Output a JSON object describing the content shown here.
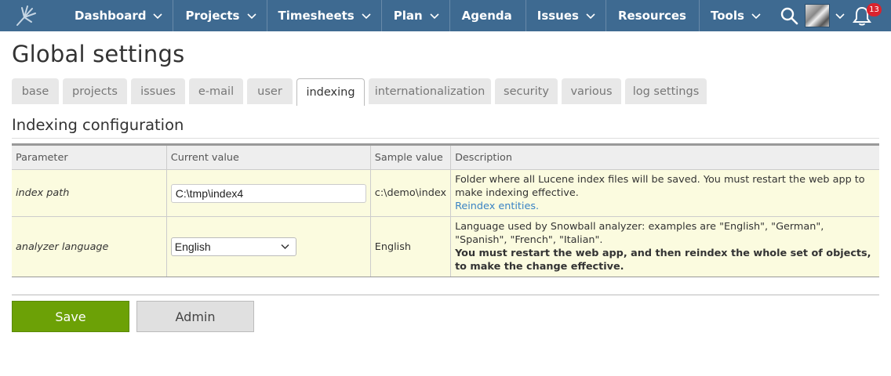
{
  "topbar": {
    "logo_icon": "hand-logo-icon",
    "nav": [
      {
        "label": "Dashboard",
        "has_menu": true
      },
      {
        "label": "Projects",
        "has_menu": true
      },
      {
        "label": "Timesheets",
        "has_menu": true
      },
      {
        "label": "Plan",
        "has_menu": true
      },
      {
        "label": "Agenda",
        "has_menu": false
      },
      {
        "label": "Issues",
        "has_menu": true
      },
      {
        "label": "Resources",
        "has_menu": false
      },
      {
        "label": "Tools",
        "has_menu": true
      }
    ],
    "notifications_count": "13",
    "bar_color": "#3e6a91"
  },
  "page": {
    "title": "Global settings"
  },
  "tabs": [
    {
      "label": "base",
      "active": false
    },
    {
      "label": "projects",
      "active": false
    },
    {
      "label": "issues",
      "active": false
    },
    {
      "label": "e-mail",
      "active": false
    },
    {
      "label": "user",
      "active": false
    },
    {
      "label": "indexing",
      "active": true
    },
    {
      "label": "internationalization",
      "active": false
    },
    {
      "label": "security",
      "active": false
    },
    {
      "label": "various",
      "active": false
    },
    {
      "label": "log settings",
      "active": false
    }
  ],
  "section": {
    "title": "Indexing configuration"
  },
  "table": {
    "headers": {
      "parameter": "Parameter",
      "current_value": "Current value",
      "sample_value": "Sample value",
      "description": "Description"
    },
    "rows": {
      "index_path": {
        "parameter": "index path",
        "value": "C:\\tmp\\index4",
        "sample": "c:\\demo\\index",
        "description": "Folder where all Lucene index files will be saved. You must restart the web app to make indexing effective.",
        "link": "Reindex entities."
      },
      "analyzer_language": {
        "parameter": "analyzer language",
        "value": "English",
        "sample": "English",
        "description": "Language used by Snowball analyzer: examples are \"English\", \"German\", \"Spanish\", \"French\", \"Italian\".",
        "note": "You must restart the web app, and then reindex the whole set of objects, to make the change effective."
      }
    }
  },
  "buttons": {
    "save": "Save",
    "admin": "Admin",
    "save_color": "#6ca106"
  }
}
